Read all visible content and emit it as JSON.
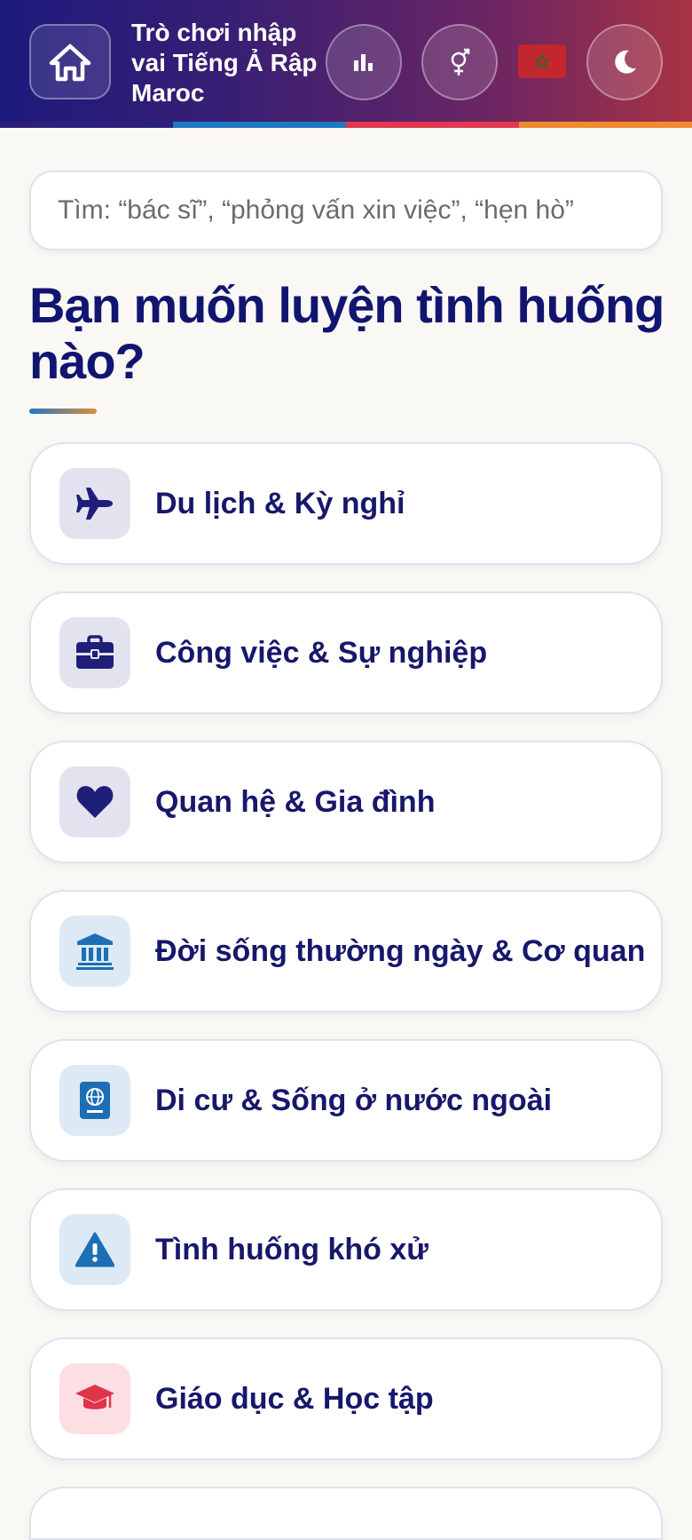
{
  "header": {
    "app_title": "Trò chơi nhập vai Tiếng Ả Rập Maroc",
    "home_icon": "home-icon",
    "stats_icon": "bar-chart-icon",
    "gender_icon": "gender-icon",
    "flag_icon": "morocco-flag-icon",
    "theme_icon": "moon-icon",
    "stripe_colors": [
      "#2b1f7b",
      "#1f79c2",
      "#e13850",
      "#f08a30"
    ]
  },
  "search": {
    "placeholder": "Tìm: “bác sĩ”, “phỏng vấn xin việc”, “hẹn hò”"
  },
  "main": {
    "heading": "Bạn muốn luyện tình huống nào?",
    "categories": [
      {
        "label": "Du lịch & Kỳ nghỉ",
        "icon": "airplane-icon",
        "color": "#1f1f7a"
      },
      {
        "label": "Công việc & Sự nghiệp",
        "icon": "briefcase-icon",
        "color": "#1f1f7a"
      },
      {
        "label": "Quan hệ & Gia đình",
        "icon": "heart-icon",
        "color": "#1f1f7a"
      },
      {
        "label": "Đời sống thường ngày & Cơ quan",
        "icon": "institution-icon",
        "color": "#1c6fb5"
      },
      {
        "label": "Di cư & Sống ở nước ngoài",
        "icon": "passport-icon",
        "color": "#1c6fb5"
      },
      {
        "label": "Tình huống khó xử",
        "icon": "warning-icon",
        "color": "#1c6fb5"
      },
      {
        "label": "Giáo dục & Học tập",
        "icon": "graduation-cap-icon",
        "color": "#e0344c"
      }
    ]
  }
}
